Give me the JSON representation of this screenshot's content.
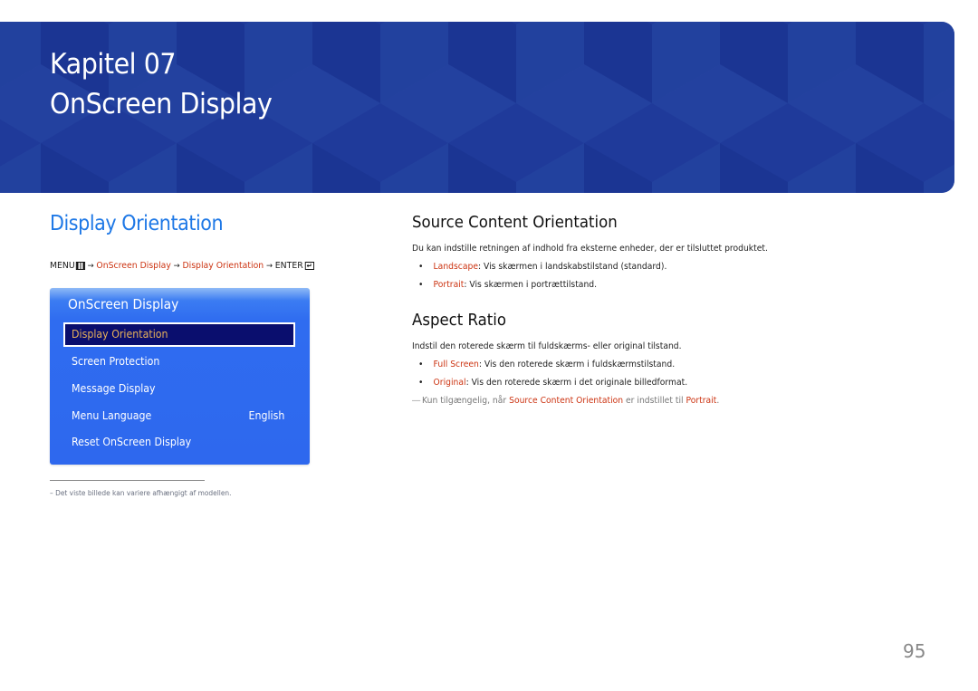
{
  "banner": {
    "chapter": "Kapitel 07",
    "title": "OnScreen Display",
    "background_color": "#1f3a9a"
  },
  "left": {
    "section_title": "Display Orientation",
    "menu_path": {
      "menu_label": "MENU",
      "menu_icon": "menu-grid-icon",
      "steps": [
        "OnScreen Display",
        "Display Orientation"
      ],
      "enter_label": "ENTER",
      "enter_icon": "enter-return-icon",
      "arrow": "→"
    },
    "osd_panel": {
      "title": "OnScreen Display",
      "items": [
        {
          "label": "Display Orientation",
          "value": "",
          "selected": true
        },
        {
          "label": "Screen Protection",
          "value": "",
          "selected": false
        },
        {
          "label": "Message Display",
          "value": "",
          "selected": false
        },
        {
          "label": "Menu Language",
          "value": "English",
          "selected": false
        },
        {
          "label": "Reset OnScreen Display",
          "value": "",
          "selected": false
        }
      ]
    },
    "footnote": "–  Det viste billede kan variere afhængigt af modellen."
  },
  "right": {
    "source_content": {
      "heading": "Source Content Orientation",
      "description": "Du kan indstille retningen af indhold fra eksterne enheder, der er tilsluttet produktet.",
      "bullets": [
        {
          "term": "Landscape",
          "text": ": Vis skærmen i landskabstilstand (standard)."
        },
        {
          "term": "Portrait",
          "text": ": Vis skærmen i portrættilstand."
        }
      ]
    },
    "aspect_ratio": {
      "heading": "Aspect Ratio",
      "description": "Indstil den roterede skærm til fuldskærms- eller original tilstand.",
      "bullets": [
        {
          "term": "Full Screen",
          "text": ": Vis den roterede skærm i fuldskærmstilstand."
        },
        {
          "term": "Original",
          "text": ": Vis den roterede skærm i det originale billedformat."
        }
      ],
      "note": {
        "dash": "―",
        "prefix": "Kun tilgængelig, når ",
        "term1": "Source Content Orientation",
        "middle": " er indstillet til ",
        "term2": "Portrait",
        "suffix": "."
      }
    }
  },
  "page_number": "95",
  "colors": {
    "accent_blue": "#1e78e6",
    "link_red": "#cc3311",
    "osd_blue": "#2e68ee",
    "osd_selected_bg": "#0a0e6e",
    "osd_selected_text": "#e8b25a"
  }
}
